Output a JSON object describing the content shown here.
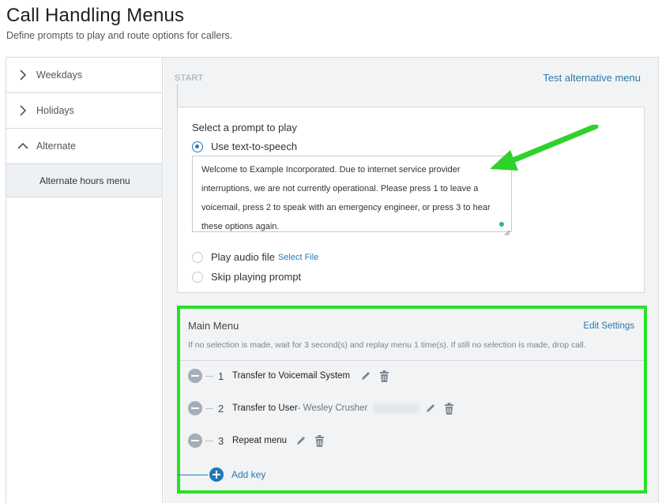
{
  "header": {
    "title": "Call Handling Menus",
    "subtitle": "Define prompts to play and route options for callers."
  },
  "sidebar": {
    "items": [
      {
        "label": "Weekdays",
        "icon": "chevron-right-icon",
        "expanded": false
      },
      {
        "label": "Holidays",
        "icon": "chevron-right-icon",
        "expanded": false
      },
      {
        "label": "Alternate",
        "icon": "chevron-up-icon",
        "expanded": true
      }
    ],
    "subitems": [
      {
        "label": "Alternate hours menu",
        "selected": true
      }
    ]
  },
  "flow": {
    "start_label": "START",
    "test_link": "Test alternative menu"
  },
  "prompt": {
    "heading": "Select a prompt to play",
    "tts_option": "Use text-to-speech",
    "tts_text": "Welcome to Example Incorporated. Due to internet service provider interruptions, we are not currently operational. Please press 1 to leave a voicemail, press 2 to speak with an emergency engineer, or press 3 to hear these options again.",
    "audio_option": "Play audio file",
    "select_file": "Select File",
    "skip_option": "Skip playing prompt",
    "selected": "tts"
  },
  "menu": {
    "title": "Main Menu",
    "edit_settings": "Edit Settings",
    "description": "If no selection is made, wait for 3 second(s) and replay menu 1 time(s). If still no selection is made, drop call.",
    "keys": [
      {
        "num": "1",
        "action": "Transfer to Voicemail System",
        "target": ""
      },
      {
        "num": "2",
        "action": "Transfer to User",
        "target": " - Wesley Crusher"
      },
      {
        "num": "3",
        "action": "Repeat menu",
        "target": ""
      }
    ],
    "add_key": "Add key"
  },
  "colors": {
    "accent": "#2a7ab0",
    "highlight": "#27e224",
    "arrow": "#2fd12b"
  }
}
